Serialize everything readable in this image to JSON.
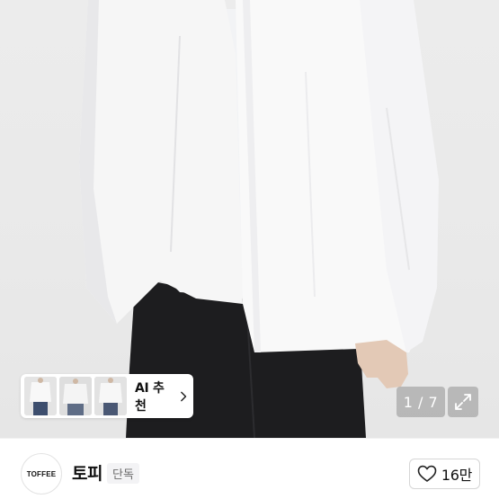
{
  "product_image": {
    "ai_recommend": {
      "label": "AI 추천",
      "thumbnails": [
        "thumbnail-1",
        "thumbnail-2",
        "thumbnail-3"
      ],
      "chevron_icon": "chevron-right-icon"
    },
    "pager": {
      "text": "1 / 7",
      "current": 1,
      "total": 7
    },
    "expand_icon": "expand-icon"
  },
  "seller": {
    "logo_text": "TOFFEE",
    "name": "토피",
    "badge": "단독"
  },
  "like": {
    "icon": "heart-icon",
    "count": "16만"
  },
  "colors": {
    "photo_background": "#e9e9e9",
    "shirt": "#f7f7f7",
    "pants": "#1c1c1c",
    "overlay": "#787878"
  }
}
